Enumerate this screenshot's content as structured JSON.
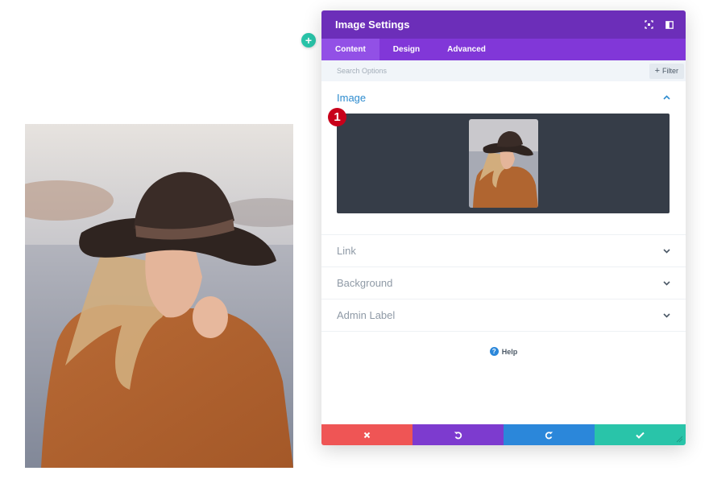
{
  "modal": {
    "title": "Image Settings",
    "tabs": [
      {
        "label": "Content"
      },
      {
        "label": "Design"
      },
      {
        "label": "Advanced"
      }
    ],
    "search": {
      "placeholder": "Search Options"
    },
    "filter_label": "Filter",
    "sections": {
      "image": {
        "title": "Image",
        "marker": "1"
      },
      "link": {
        "title": "Link"
      },
      "background": {
        "title": "Background"
      },
      "admin_label": {
        "title": "Admin Label"
      }
    },
    "help_label": "Help"
  },
  "colors": {
    "header": "#6c2eb9",
    "tabs": "#8137d8",
    "cancel": "#ef5555",
    "undo": "#7d3bcf",
    "redo": "#2b87da",
    "save": "#29c4a9",
    "marker": "#c8001a"
  },
  "icons": {
    "add": "plus-icon",
    "header": [
      "fullscreen-icon",
      "sidebar-toggle-icon"
    ],
    "footer": [
      "close-icon",
      "undo-icon",
      "redo-icon",
      "check-icon"
    ]
  }
}
